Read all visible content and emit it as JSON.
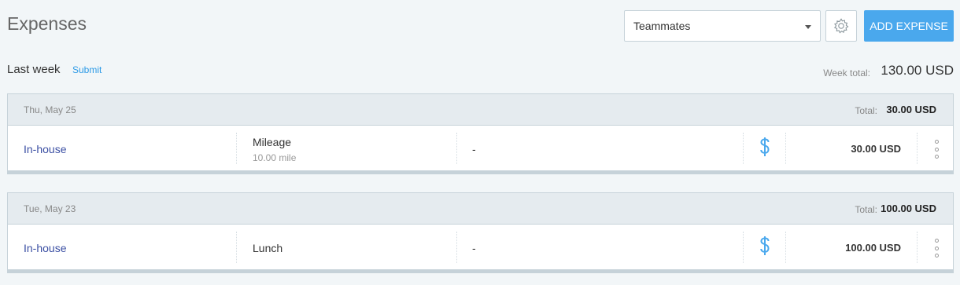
{
  "header": {
    "title": "Expenses",
    "filter_value": "Teammates",
    "add_button_label": "ADD EXPENSE"
  },
  "week": {
    "label": "Last week",
    "submit_label": "Submit",
    "total_label": "Week total:",
    "total_value": "130.00 USD"
  },
  "days": [
    {
      "date": "Thu, May 25",
      "total_label": "Total:",
      "total_value": "30.00 USD",
      "entries": [
        {
          "project": "In-house",
          "category": "Mileage",
          "quantity": "10.00 mile",
          "note": "-",
          "billable_icon": "dollar-icon",
          "amount": "30.00 USD"
        }
      ]
    },
    {
      "date": "Tue, May 23",
      "total_label": "Total:",
      "total_value": "100.00 USD",
      "entries": [
        {
          "project": "In-house",
          "category": "Lunch",
          "quantity": "",
          "note": "-",
          "billable_icon": "dollar-icon",
          "amount": "100.00 USD"
        }
      ]
    }
  ],
  "colors": {
    "accent": "#4aa8ed",
    "link": "#2c9ae6",
    "project_link": "#3b4fa3",
    "background": "#f2f6f8"
  }
}
